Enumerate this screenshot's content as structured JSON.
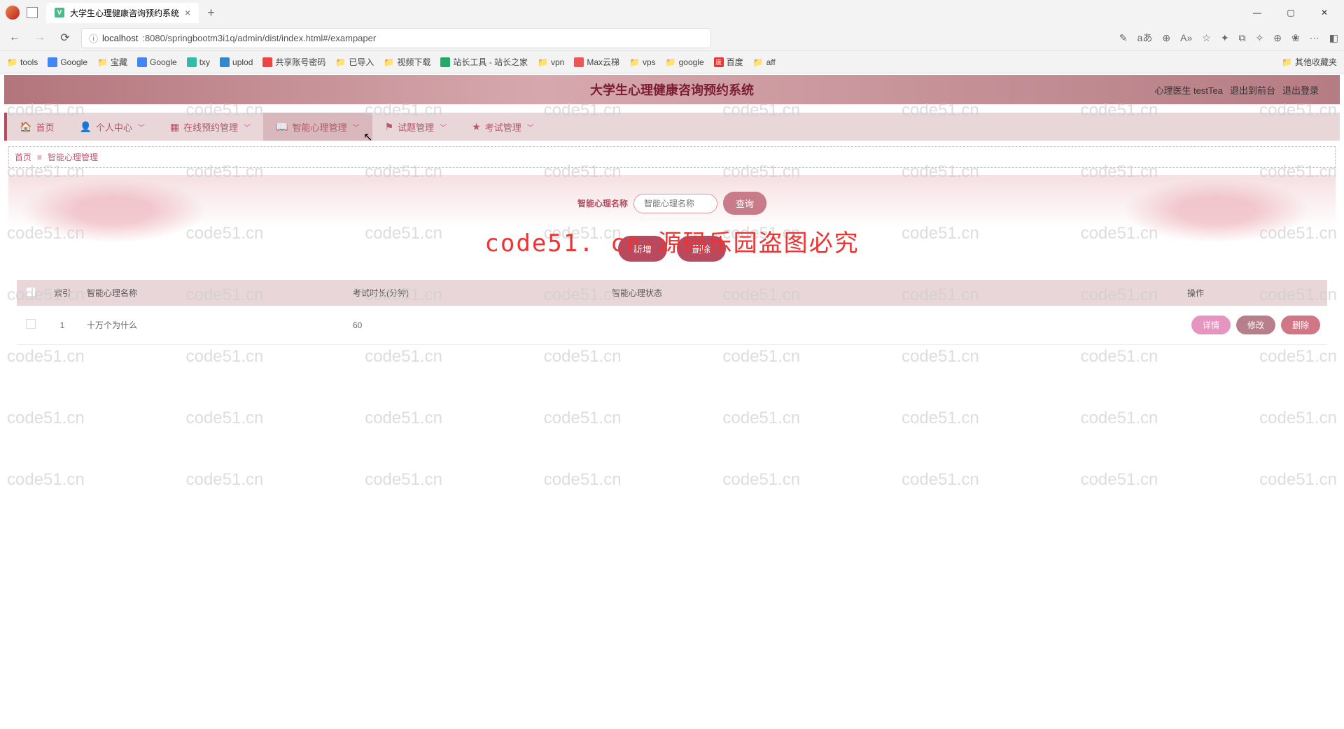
{
  "browser": {
    "tab_title": "大学生心理健康咨询预约系统",
    "url_host": "localhost",
    "url_path": ":8080/springbootm3i1q/admin/dist/index.html#/exampaper",
    "bookmarks": [
      "tools",
      "Google",
      "宝藏",
      "Google",
      "txy",
      "uplod",
      "共享账号密码",
      "已导入",
      "视频下载",
      "站长工具 - 站长之家",
      "vpn",
      "Max云梯",
      "vps",
      "google",
      "百度",
      "aff"
    ],
    "bookmarks_more": "其他收藏夹"
  },
  "banner": {
    "title": "大学生心理健康咨询预约系统",
    "user_role": "心理医生 testTea",
    "front_link": "退出到前台",
    "logout": "退出登录"
  },
  "nav": [
    {
      "icon": "🏠",
      "label": "首页",
      "chev": false
    },
    {
      "icon": "👤",
      "label": "个人中心",
      "chev": true
    },
    {
      "icon": "▦",
      "label": "在线预约管理",
      "chev": true
    },
    {
      "icon": "📖",
      "label": "智能心理管理",
      "chev": true,
      "active": true
    },
    {
      "icon": "⚑",
      "label": "试题管理",
      "chev": true
    },
    {
      "icon": "★",
      "label": "考试管理",
      "chev": true
    }
  ],
  "breadcrumb": {
    "home": "首页",
    "current": "智能心理管理"
  },
  "search": {
    "label": "智能心理名称",
    "placeholder": "智能心理名称",
    "query_btn": "查询"
  },
  "actions": {
    "add": "新增",
    "delete": "删除"
  },
  "table": {
    "headers": {
      "index": "索引",
      "name": "智能心理名称",
      "duration": "考试时长(分钟)",
      "status": "智能心理状态",
      "ops": "操作"
    },
    "rows": [
      {
        "index": "1",
        "name": "十万个为什么",
        "duration": "60",
        "status": ""
      }
    ],
    "ops": {
      "detail": "详情",
      "edit": "修改",
      "delete": "删除"
    }
  },
  "watermark": "code51.cn",
  "big_watermark": "code51. cn-源码乐园盗图必究"
}
